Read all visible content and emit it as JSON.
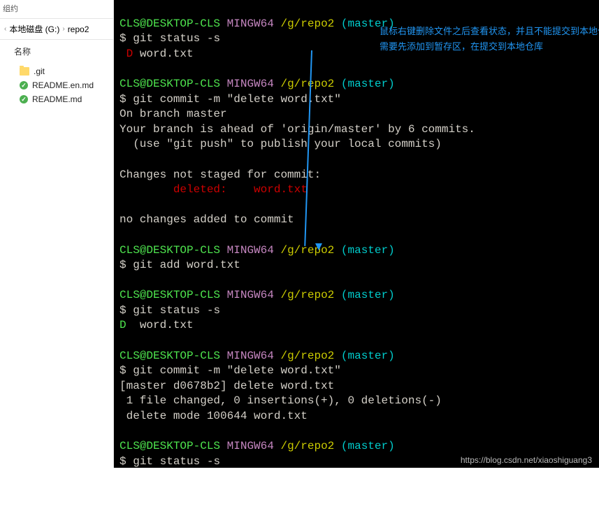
{
  "sidebar": {
    "org_label": "组约",
    "breadcrumb": {
      "chev1": "‹",
      "part1": "本地磁盘 (G:)",
      "sep": "›",
      "part2": "repo2"
    },
    "name_header": "名称",
    "items": [
      {
        "type": "folder",
        "label": ".git"
      },
      {
        "type": "file",
        "label": "README.en.md"
      },
      {
        "type": "file",
        "label": "README.md"
      }
    ]
  },
  "terminal": {
    "prompt_user": "CLS@DESKTOP-CLS",
    "prompt_host": "MINGW64",
    "prompt_path": "/g/repo2",
    "prompt_branch": "(master)",
    "dollar": "$",
    "blocks": [
      {
        "cmd": "git status -s",
        "out_lines": [
          {
            "prefix_red": " D ",
            "text": "word.txt"
          }
        ]
      },
      {
        "cmd": "git commit -m \"delete word.txt\"",
        "out_plain": [
          "On branch master",
          "Your branch is ahead of 'origin/master' by 6 commits.",
          "  (use \"git push\" to publish your local commits)",
          "",
          "Changes not staged for commit:"
        ],
        "out_deleted": "        deleted:    word.txt",
        "out_plain2": [
          "",
          "no changes added to commit"
        ]
      },
      {
        "cmd": "git add word.txt",
        "out_plain": []
      },
      {
        "cmd": "git status -s",
        "out_lines": [
          {
            "prefix_green": "D  ",
            "text": "word.txt"
          }
        ]
      },
      {
        "cmd": "git commit -m \"delete word.txt\"",
        "out_plain": [
          "[master d0678b2] delete word.txt",
          " 1 file changed, 0 insertions(+), 0 deletions(-)",
          " delete mode 100644 word.txt"
        ]
      },
      {
        "cmd": "git status -s",
        "out_plain": []
      }
    ]
  },
  "annotations": {
    "line1": "鼠标右键删除文件之后查看状态，并且不能提交到本地仓库",
    "line2": "需要先添加到暂存区，在提交到本地仓库"
  },
  "watermark": "https://blog.csdn.net/xiaoshiguang3"
}
